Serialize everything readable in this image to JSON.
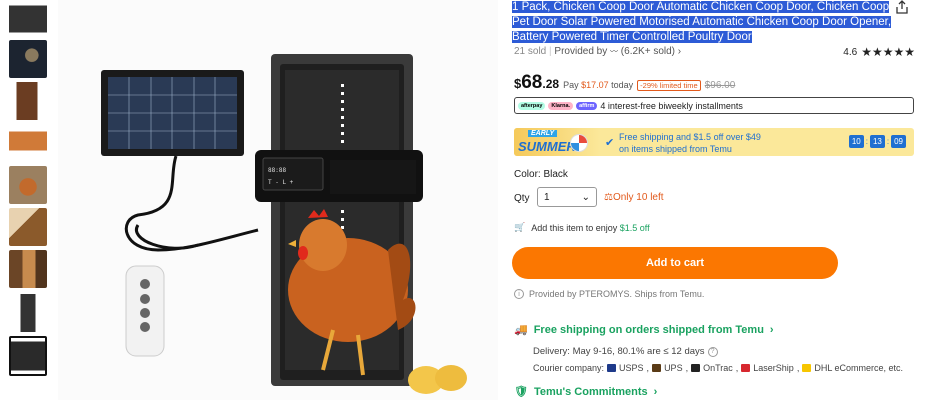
{
  "product": {
    "title": "1 Pack, Chicken Coop Door Automatic Chicken Coop Door, Chicken Coop Pet Door Solar Powered Motorised Automatic Chicken Coop Door Opener, Battery Powered Timer Controlled Poultry Door",
    "sold": "21 sold",
    "provided_by_label": "Provided by",
    "seller_rating_text": "(6.2K+ sold)",
    "rating": "4.6",
    "stars_display": "★★★★★",
    "image_icon": "chicken-coop-door-product-photo"
  },
  "price": {
    "currency": "$",
    "dollars": "68",
    "cents": ".28",
    "pay_label": "Pay",
    "pay_amount": "$17.07",
    "pay_suffix": "today",
    "limited_badge": "-29% limited time",
    "old_price": "$96.00"
  },
  "installments": {
    "providers": [
      "afterpay",
      "Klarna.",
      "affirm"
    ],
    "text": "4 interest-free biweekly installments"
  },
  "promo": {
    "early": "EARLY",
    "summer": "SUMMER",
    "line1": "Free shipping and $1.5 off over $49",
    "line2": "on items shipped from Temu",
    "timer": [
      "10",
      "13",
      "09"
    ]
  },
  "options": {
    "color_label": "Color: Black",
    "qty_label": "Qty",
    "qty_value": "1",
    "stock_text": "Only 10 left",
    "add_enjoy_text": "Add this item to enjoy",
    "add_enjoy_amount": "$1.5 off"
  },
  "cart": {
    "button_label": "Add to cart"
  },
  "shipping": {
    "provided_text": "Provided by PTEROMYS. Ships from Temu.",
    "free_shipping": "Free shipping on orders shipped from Temu",
    "delivery_text": "Delivery: May 9-16, 80.1% are ≤ 12 days",
    "courier_label": "Courier company:",
    "couriers": [
      "USPS",
      "UPS",
      "OnTrac",
      "LaserShip",
      "DHL eCommerce, etc."
    ],
    "courier_colors": [
      "#1e3a8a",
      "#5a3b16",
      "#222222",
      "#d7282f",
      "#f7c600"
    ],
    "commitments": "Temu's Commitments"
  },
  "colors": {
    "accent": "#fb7701",
    "green": "#1aa260",
    "promo_blue": "#1f6fd1",
    "selection": "#2d5bd6"
  }
}
